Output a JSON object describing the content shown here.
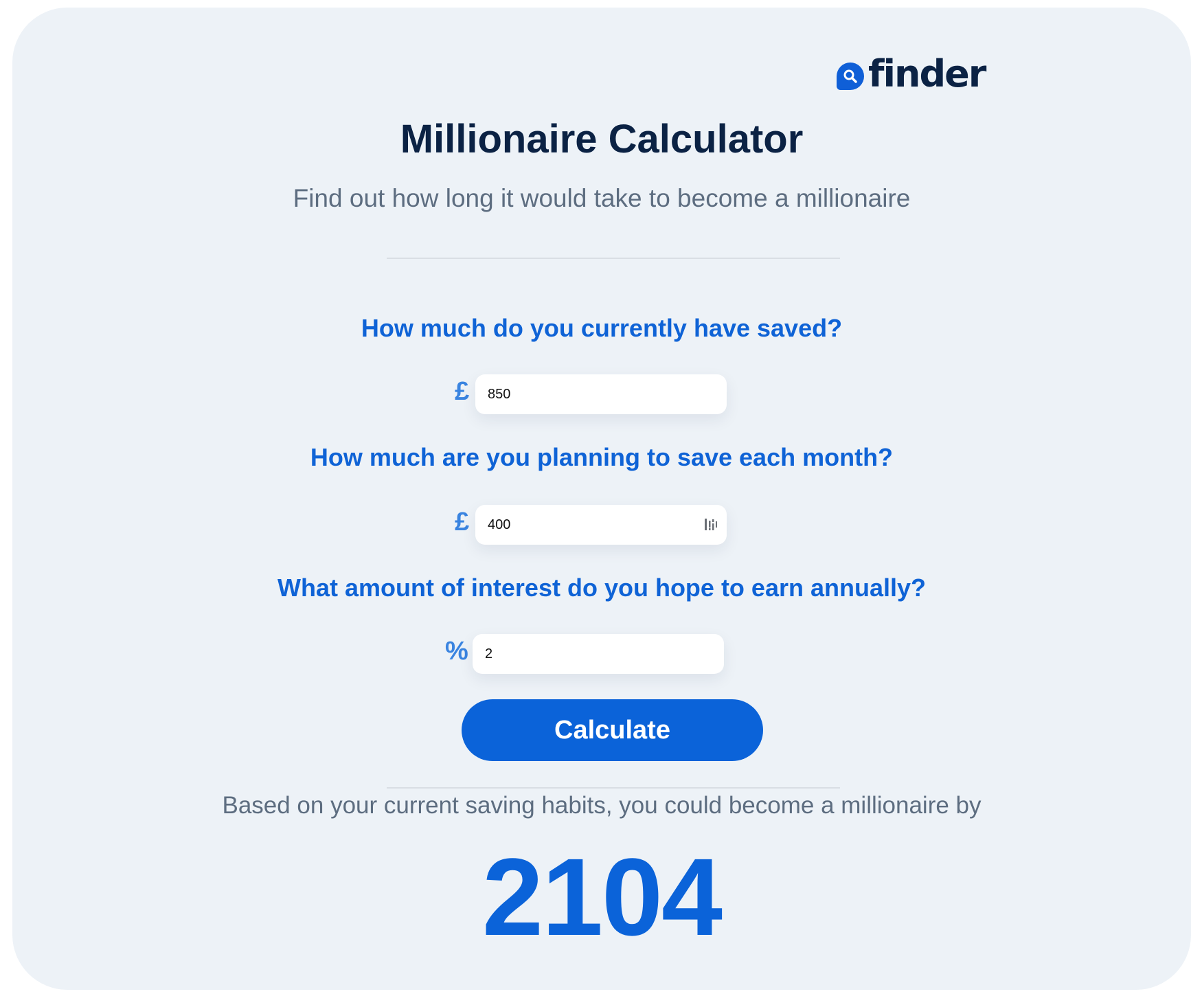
{
  "brand": {
    "logo_text": "finder",
    "accent_color": "#0b63d9",
    "dark_color": "#0b2244"
  },
  "header": {
    "title": "Millionaire Calculator",
    "subtitle": "Find out how long it would take to become a millionaire"
  },
  "form": {
    "fields": [
      {
        "question": "How much do you currently have saved?",
        "unit": "£",
        "value": "850"
      },
      {
        "question": "How much are you planning to save each month?",
        "unit": "£",
        "value": "400",
        "icon": "autofill-icon"
      },
      {
        "question": "What amount of interest do you hope to earn annually?",
        "unit": "%",
        "value": "2"
      }
    ],
    "submit_label": "Calculate"
  },
  "result": {
    "text": "Based on your current saving habits, you could become a millionaire by",
    "year": "2104"
  }
}
